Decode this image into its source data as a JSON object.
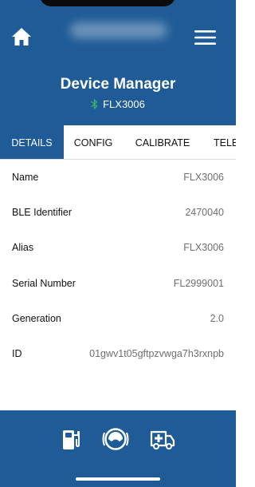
{
  "header": {
    "title": "Device Manager",
    "device_name": "FLX3006",
    "bluetooth_color": "#38b36b"
  },
  "tabs": [
    {
      "label": "DETAILS",
      "active": true
    },
    {
      "label": "CONFIG",
      "active": false
    },
    {
      "label": "CALIBRATE",
      "active": false
    },
    {
      "label": "TELE",
      "active": false
    }
  ],
  "details": [
    {
      "label": "Name",
      "value": "FLX3006"
    },
    {
      "label": "BLE Identifier",
      "value": "2470040"
    },
    {
      "label": "Alias",
      "value": "FLX3006"
    },
    {
      "label": "Serial Number",
      "value": "FL2999001"
    },
    {
      "label": "Generation",
      "value": "2.0"
    },
    {
      "label": "ID",
      "value": "01gwv1t05gftpzvwga7h3rxnpb"
    }
  ],
  "bottom_nav": {
    "icons": [
      "fuel-pump-icon",
      "gauge-icon",
      "ambulance-icon"
    ]
  },
  "colors": {
    "primary": "#1f5b96",
    "value_text": "#6f6f6f"
  }
}
